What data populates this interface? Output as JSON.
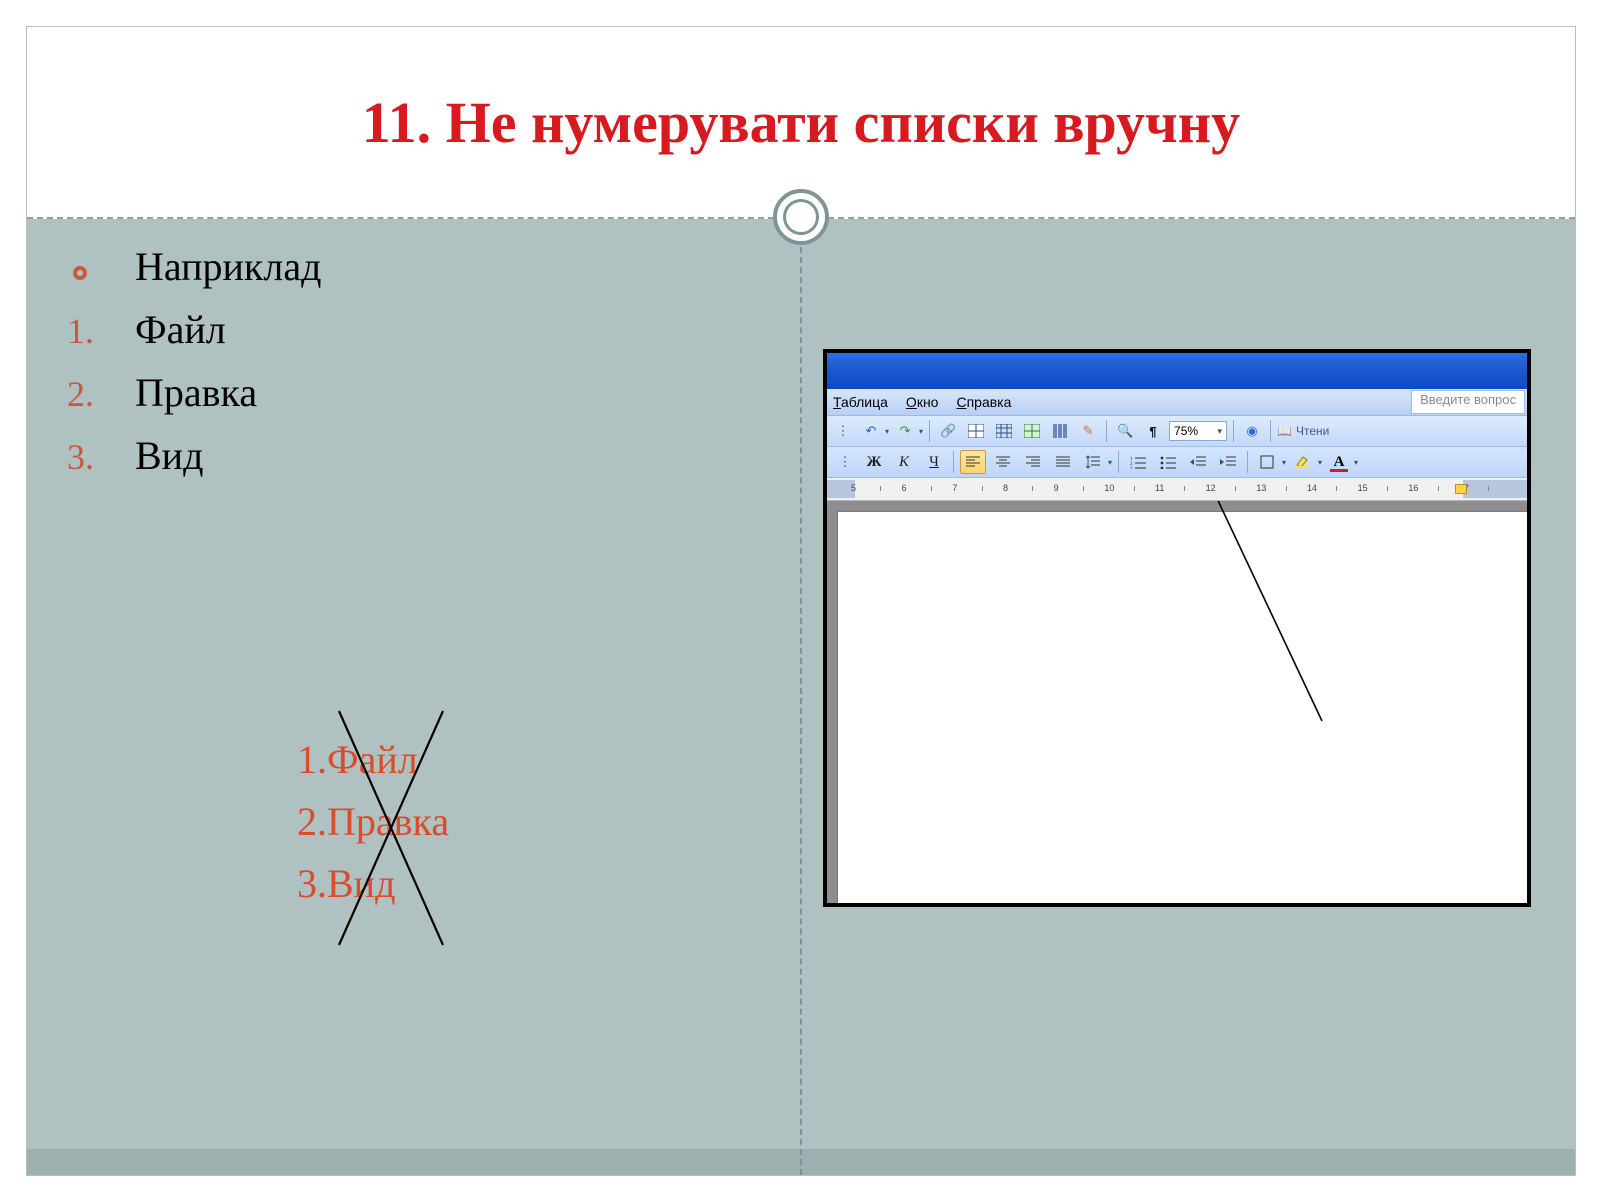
{
  "title": "11. Не нумерувати списки вручну",
  "left": {
    "bullet_label": "Наприклад",
    "numbered": [
      {
        "num": "1.",
        "text": "Файл"
      },
      {
        "num": "2.",
        "text": "Правка"
      },
      {
        "num": "3.",
        "text": "Вид"
      }
    ]
  },
  "wrong_example": {
    "lines": [
      "1.Файл",
      "2.Правка",
      "3.Вид"
    ]
  },
  "word": {
    "menubar": {
      "table": "Таблица",
      "window": "Окно",
      "help": "Справка"
    },
    "question_placeholder": "Введите вопрос",
    "zoom": "75%",
    "reading_label": "Чтени",
    "format_labels": {
      "bold": "Ж",
      "italic": "К",
      "underline": "Ч",
      "font_color": "A"
    },
    "ruler": {
      "start": 5,
      "end": 17
    }
  }
}
